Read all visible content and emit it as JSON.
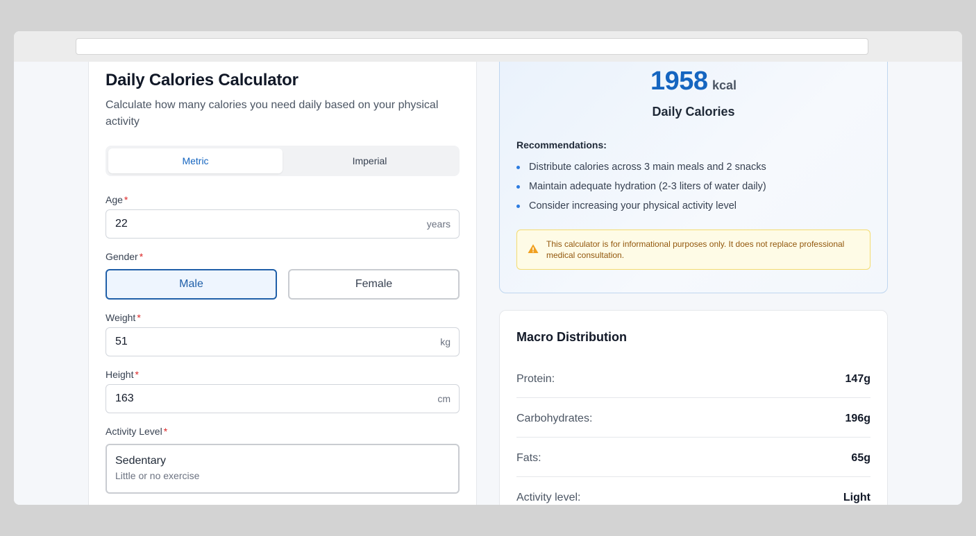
{
  "browser": {
    "url": ""
  },
  "calculator": {
    "title": "Daily Calories Calculator",
    "subtitle": "Calculate how many calories you need daily based on your physical activity",
    "units": {
      "metric_label": "Metric",
      "imperial_label": "Imperial",
      "selected": "Metric"
    },
    "age": {
      "label": "Age",
      "required": "*",
      "value": "22",
      "unit": "years"
    },
    "gender": {
      "label": "Gender",
      "required": "*",
      "male_label": "Male",
      "female_label": "Female",
      "selected": "Male"
    },
    "weight": {
      "label": "Weight",
      "required": "*",
      "value": "51",
      "unit": "kg"
    },
    "height": {
      "label": "Height",
      "required": "*",
      "value": "163",
      "unit": "cm"
    },
    "activity": {
      "label": "Activity Level",
      "required": "*",
      "selected_title": "Sedentary",
      "selected_desc": "Little or no exercise"
    }
  },
  "result": {
    "calories": "1958",
    "calories_unit": "kcal",
    "calories_label": "Daily Calories",
    "recommendations_title": "Recommendations:",
    "recommendations": [
      "Distribute calories across 3 main meals and 2 snacks",
      "Maintain adequate hydration (2-3 liters of water daily)",
      "Consider increasing your physical activity level"
    ],
    "warning_icon": "warning-triangle-icon",
    "warning_text": "This calculator is for informational purposes only. It does not replace professional medical consultation."
  },
  "macros": {
    "title": "Macro Distribution",
    "rows": [
      {
        "label": "Protein:",
        "value": "147g"
      },
      {
        "label": "Carbohydrates:",
        "value": "196g"
      },
      {
        "label": "Fats:",
        "value": "65g"
      },
      {
        "label": "Activity level:",
        "value": "Light"
      }
    ]
  },
  "colors": {
    "accent": "#1565c0",
    "required": "#dc2626",
    "warning_bg": "#fefbe6",
    "warning_border": "#f4dc6e"
  }
}
